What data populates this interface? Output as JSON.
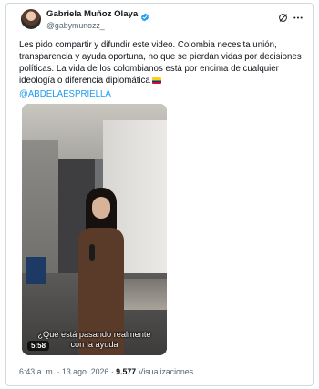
{
  "author": {
    "display_name": "Gabriela Muñoz Olaya",
    "handle": "@gabymunozz_",
    "verified": true
  },
  "icons": {
    "avatar": "profile-photo",
    "verified": "verified-badge-icon",
    "grok": "grok-icon",
    "more": "more-options-icon",
    "flag": "colombia-flag-emoji"
  },
  "tweet": {
    "text": "Les pido compartir y difundir este video. Colombia necesita unión, transparencia y ayuda oportuna, no que se pierdan vidas por decisiones políticas. La vida de los colombianos está por encima de cualquier ideología o diferencia diplomática",
    "mention": "@ABDELAESPRIELLA"
  },
  "video": {
    "caption_line1": "¿Qué está pasando realmente",
    "caption_line2": "con la ayuda",
    "duration": "5:58"
  },
  "meta": {
    "time": "6:43 a. m.",
    "separator": " · ",
    "date": "13 ago. 2026",
    "views_count": "9.577",
    "views_label": "Visualizaciones"
  },
  "colors": {
    "link": "#1d9bf0",
    "verified": "#1d9bf0",
    "secondary_text": "#536471",
    "border": "#cfd9de"
  }
}
